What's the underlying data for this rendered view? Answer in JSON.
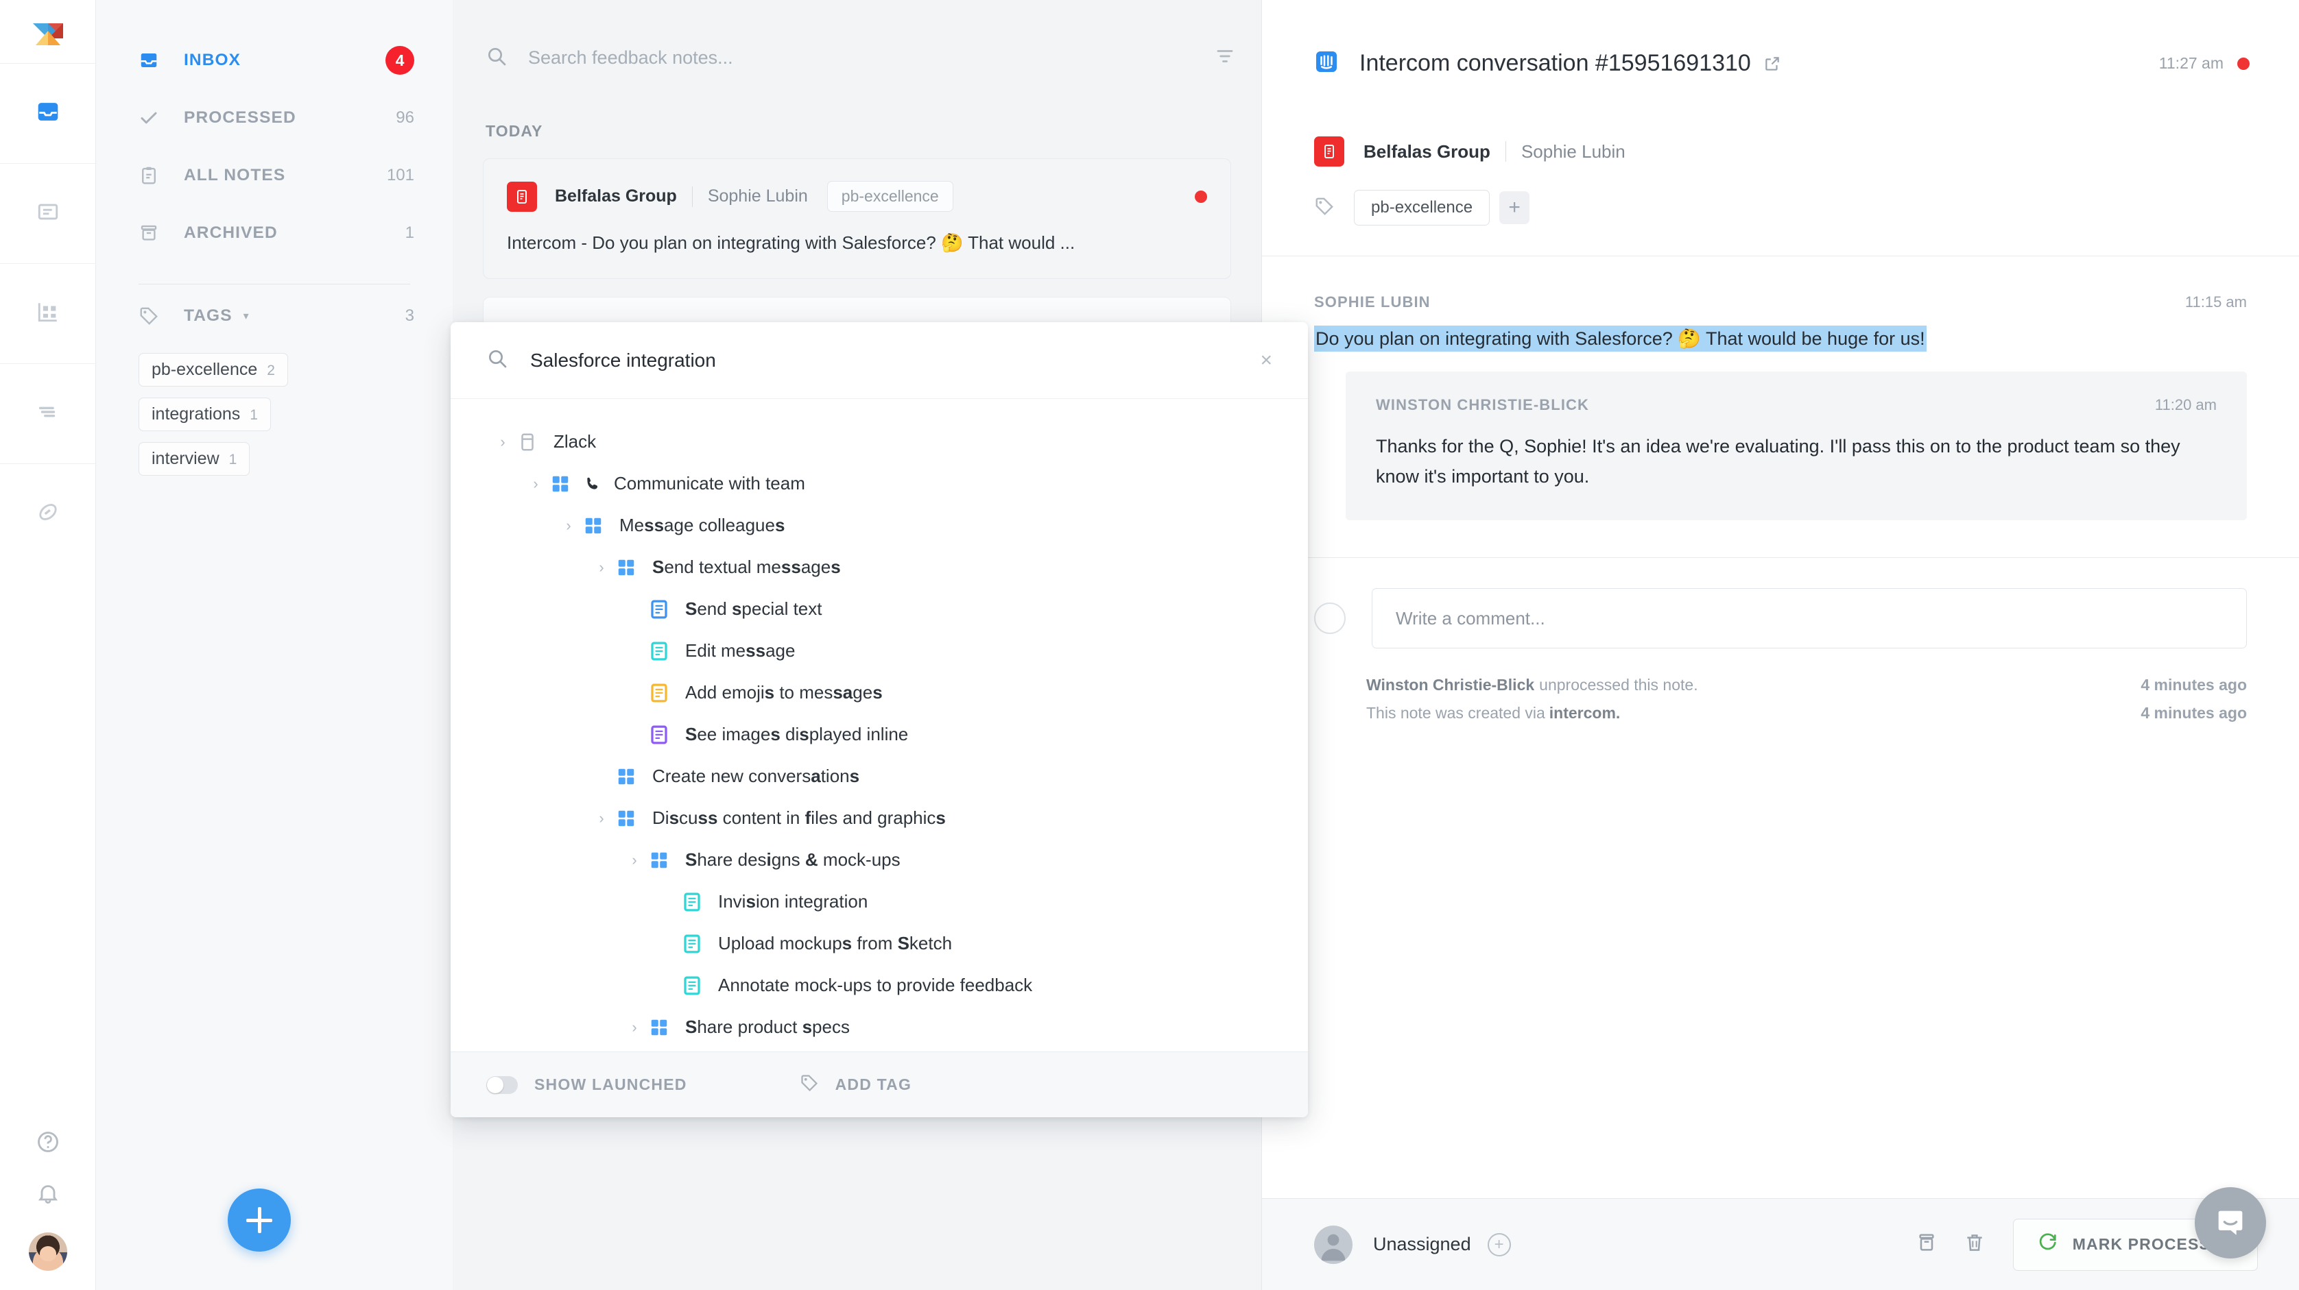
{
  "rail": {
    "logo": "productboard-logo",
    "items": [
      {
        "name": "inbox",
        "icon": "inbox-icon",
        "active": true
      },
      {
        "name": "notes",
        "icon": "note-icon",
        "active": false
      },
      {
        "name": "features",
        "icon": "grid-board-icon",
        "active": false
      },
      {
        "name": "roadmap",
        "icon": "roadmap-icon",
        "active": false
      },
      {
        "name": "portal",
        "icon": "portal-icon",
        "active": false
      }
    ],
    "bottom": [
      {
        "name": "help",
        "icon": "help-circle-icon"
      },
      {
        "name": "notifications",
        "icon": "bell-icon"
      },
      {
        "name": "account",
        "icon": "user-avatar"
      }
    ]
  },
  "sidebar": {
    "nav": [
      {
        "label": "INBOX",
        "count": "4",
        "icon": "inbox-icon",
        "active": true,
        "badge": true
      },
      {
        "label": "PROCESSED",
        "count": "96",
        "icon": "check-icon",
        "active": false,
        "badge": false
      },
      {
        "label": "ALL NOTES",
        "count": "101",
        "icon": "clipboard-icon",
        "active": false,
        "badge": false
      },
      {
        "label": "ARCHIVED",
        "count": "1",
        "icon": "archive-icon",
        "active": false,
        "badge": false
      }
    ],
    "tags": {
      "title": "TAGS",
      "icon": "tag-icon",
      "caret": "chevron-down-icon",
      "count": "3",
      "items": [
        {
          "label": "pb-excellence",
          "count": "2"
        },
        {
          "label": "integrations",
          "count": "1"
        },
        {
          "label": "interview",
          "count": "1"
        }
      ]
    },
    "fab": {
      "label": "+",
      "name": "add-note-button"
    }
  },
  "notelist": {
    "search": {
      "placeholder": "Search feedback notes...",
      "value": "",
      "icon": "search-icon"
    },
    "filter_icon": "filter-icon",
    "day_label": "TODAY",
    "notes": [
      {
        "source_icon": "intercom-source-icon",
        "company": "Belfalas Group",
        "person": "Sophie Lubin",
        "tag": "pb-excellence",
        "unread": true,
        "body": "Intercom - Do you plan on integrating with Salesforce? 🤔 That would ..."
      }
    ]
  },
  "detail": {
    "header": {
      "icon": "intercom-icon",
      "title": "Intercom conversation #15951691310",
      "external_link_icon": "external-link-icon",
      "time": "11:27 am",
      "unread_dot": true
    },
    "meta": {
      "source_icon": "intercom-source-icon",
      "company": "Belfalas Group",
      "person": "Sophie Lubin"
    },
    "tags": {
      "icon": "tag-icon",
      "pills": [
        "pb-excellence"
      ],
      "add_label": "+"
    },
    "thread": [
      {
        "author": "SOPHIE LUBIN",
        "time": "11:15 am",
        "text": "Do you plan on integrating with Salesforce? 🤔 That would be huge for us!",
        "highlighted": true,
        "style": "plain"
      },
      {
        "author": "WINSTON CHRISTIE-BLICK",
        "time": "11:20 am",
        "text": "Thanks for the Q, Sophie! It's an idea we're evaluating. I'll pass this on to the product team so they know it's important to you.",
        "highlighted": false,
        "style": "bubble"
      }
    ],
    "comment": {
      "placeholder": "Write a comment...",
      "value": "",
      "avatar_icon": "avatar-outline-icon"
    },
    "activity": [
      {
        "actor": "Winston Christie-Blick",
        "action": "unprocessed this note.",
        "suffix": "",
        "time": "4 minutes ago"
      },
      {
        "actor": "",
        "action": "This note was created via",
        "suffix": "intercom.",
        "time": "4 minutes ago"
      }
    ],
    "footer": {
      "assignee_label": "Unassigned",
      "assignee_icon": "user-avatar-icon",
      "add_assignee_icon": "plus-circle-icon",
      "archive_icon": "archive-icon",
      "delete_icon": "trash-icon",
      "mark_label": "MARK PROCESSED",
      "mark_icon": "refresh-icon",
      "mark_icon_color": "#4caf50"
    },
    "launcher_icon": "intercom-chat-icon"
  },
  "modal": {
    "search": {
      "value": "Salesforce integration",
      "icon": "search-icon",
      "close_icon": "close-icon"
    },
    "tree": [
      {
        "indent": 0,
        "chevron": true,
        "icon": "product-icon",
        "color": "#b6bcc4",
        "label": "Zlack",
        "bold_ranges": []
      },
      {
        "indent": 1,
        "chevron": true,
        "icon": "feature-icon",
        "color": "#4da3f5",
        "label": "Communicate with team",
        "phone": true,
        "bold_ranges": []
      },
      {
        "indent": 2,
        "chevron": true,
        "icon": "feature-icon",
        "color": "#4da3f5",
        "label": "Message colleagues",
        "bold_ranges": [
          [
            2,
            4
          ],
          [
            17,
            18
          ]
        ]
      },
      {
        "indent": 3,
        "chevron": true,
        "icon": "feature-icon",
        "color": "#4da3f5",
        "label": "Send textual messages",
        "bold_ranges": [
          [
            0,
            1
          ],
          [
            15,
            17
          ],
          [
            20,
            21
          ]
        ]
      },
      {
        "indent": 4,
        "chevron": false,
        "icon": "subfeature-icon",
        "color": "#3d93f0",
        "label": "Send special text",
        "bold_ranges": [
          [
            0,
            1
          ],
          [
            5,
            6
          ]
        ]
      },
      {
        "indent": 4,
        "chevron": false,
        "icon": "subfeature-icon",
        "color": "#2fd6d6",
        "label": "Edit message",
        "bold_ranges": [
          [
            7,
            9
          ]
        ]
      },
      {
        "indent": 4,
        "chevron": false,
        "icon": "subfeature-icon",
        "color": "#f7b731",
        "label": "Add emojis to messages",
        "bold_ranges": [
          [
            9,
            10
          ],
          [
            17,
            19
          ],
          [
            21,
            22
          ]
        ]
      },
      {
        "indent": 4,
        "chevron": false,
        "icon": "subfeature-icon",
        "color": "#8b5cf6",
        "label": "See images displayed inline",
        "bold_ranges": [
          [
            0,
            1
          ],
          [
            9,
            10
          ],
          [
            13,
            14
          ]
        ]
      },
      {
        "indent": 3,
        "chevron": false,
        "icon": "feature-icon",
        "color": "#4da3f5",
        "label": "Create new conversations",
        "bold_ranges": [
          [
            18,
            19
          ],
          [
            23,
            24
          ]
        ]
      },
      {
        "indent": 3,
        "chevron": true,
        "icon": "feature-icon",
        "color": "#4da3f5",
        "label": "Discuss content in files and graphics",
        "bold_ranges": [
          [
            2,
            3
          ],
          [
            5,
            7
          ],
          [
            19,
            20
          ],
          [
            36,
            37
          ]
        ]
      },
      {
        "indent": 4,
        "chevron": true,
        "icon": "feature-icon",
        "color": "#4da3f5",
        "label": "Share designs & mock-ups",
        "bold_ranges": [
          [
            0,
            1
          ],
          [
            9,
            10
          ],
          [
            14,
            15
          ],
          [
            24,
            25
          ]
        ]
      },
      {
        "indent": 5,
        "chevron": false,
        "icon": "subfeature-icon",
        "color": "#2fd6d6",
        "label": "Invision integration",
        "bold_ranges": [
          [
            4,
            5
          ]
        ]
      },
      {
        "indent": 5,
        "chevron": false,
        "icon": "subfeature-icon",
        "color": "#2fd6d6",
        "label": "Upload mockups from Sketch",
        "bold_ranges": [
          [
            13,
            14
          ],
          [
            20,
            21
          ]
        ]
      },
      {
        "indent": 5,
        "chevron": false,
        "icon": "subfeature-icon",
        "color": "#2fd6d6",
        "label": "Annotate mock-ups to provide feedback",
        "bold_ranges": [
          [
            17,
            18
          ]
        ]
      },
      {
        "indent": 4,
        "chevron": true,
        "icon": "feature-icon",
        "color": "#4da3f5",
        "label": "Share product specs",
        "bold_ranges": [
          [
            0,
            1
          ],
          [
            14,
            15
          ],
          [
            19,
            20
          ]
        ]
      }
    ],
    "footer": {
      "show_launched_label": "SHOW LAUNCHED",
      "show_launched_on": false,
      "add_tag_label": "ADD TAG",
      "add_tag_icon": "tag-icon"
    }
  },
  "colors": {
    "accent": "#3d9bf0",
    "danger": "#f03434",
    "highlight": "#a9d6f6",
    "success": "#4caf50",
    "intercom_red": "#ef2d2d"
  }
}
